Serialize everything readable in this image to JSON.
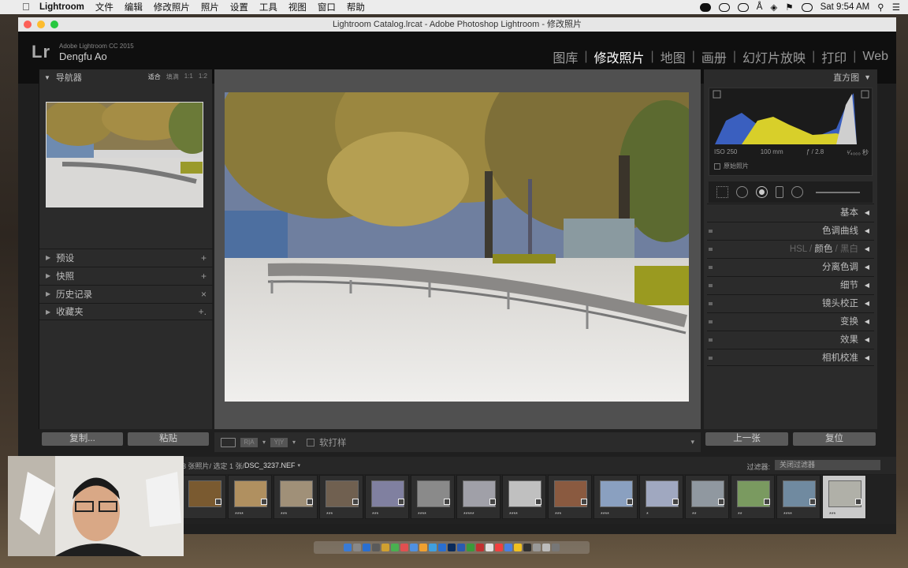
{
  "menubar": {
    "app": "Lightroom",
    "items": [
      "文件",
      "编辑",
      "修改照片",
      "照片",
      "设置",
      "工具",
      "视图",
      "窗口",
      "帮助"
    ],
    "clock": "Sat 9:54 AM"
  },
  "window": {
    "title": "Lightroom Catalog.lrcat - Adobe Photoshop Lightroom - 修改照片"
  },
  "identity": {
    "logo": "Lr",
    "product": "Adobe Lightroom CC 2015",
    "user": "Dengfu Ao"
  },
  "modules": [
    {
      "label": "图库",
      "active": false
    },
    {
      "label": "修改照片",
      "active": true
    },
    {
      "label": "地图",
      "active": false
    },
    {
      "label": "画册",
      "active": false
    },
    {
      "label": "幻灯片放映",
      "active": false
    },
    {
      "label": "打印",
      "active": false
    },
    {
      "label": "Web",
      "active": false
    }
  ],
  "left": {
    "navigator": {
      "title": "导航器",
      "options": [
        "适合",
        "填满",
        "1:1",
        "1:2"
      ]
    },
    "panels": [
      {
        "label": "预设",
        "action": "+"
      },
      {
        "label": "快照",
        "action": "+"
      },
      {
        "label": "历史记录",
        "action": "×"
      },
      {
        "label": "收藏夹",
        "action": "+."
      }
    ],
    "copy": "复制...",
    "paste": "粘贴"
  },
  "toolbar": {
    "softproof": "软打样",
    "view1": "R|A",
    "view2": "Y|Y"
  },
  "right": {
    "histogram": {
      "title": "直方图",
      "iso": "ISO 250",
      "focal": "100 mm",
      "aperture": "ƒ / 2.8",
      "shutter": "¹⁄₄₀₀₀ 秒",
      "original": "原始照片"
    },
    "panels": [
      {
        "label": "基本"
      },
      {
        "label": "色调曲线"
      },
      {
        "label": "HSL",
        "sep1": "/",
        "mid": "颜色",
        "sep2": "/",
        "last": "黑白"
      },
      {
        "label": "分离色调"
      },
      {
        "label": "细节"
      },
      {
        "label": "镜头校正"
      },
      {
        "label": "变换"
      },
      {
        "label": "效果"
      },
      {
        "label": "相机校准"
      }
    ],
    "prev": "上一张",
    "reset": "复位"
  },
  "filmstrip": {
    "info": "3 张照片/ 选定 1 张/ ",
    "file": "DSC_3237.NEF",
    "filter_label": "过滤器:",
    "filter_value": "关闭过滤器",
    "ratings": [
      "",
      "****",
      "***",
      "***",
      "***",
      "****",
      "*****",
      "****",
      "***",
      "****",
      "*",
      "**",
      "**",
      "****",
      "***"
    ]
  },
  "colors": {
    "accent": "#ffffff",
    "panel": "#2b2b2b",
    "canvas": "#505050"
  }
}
